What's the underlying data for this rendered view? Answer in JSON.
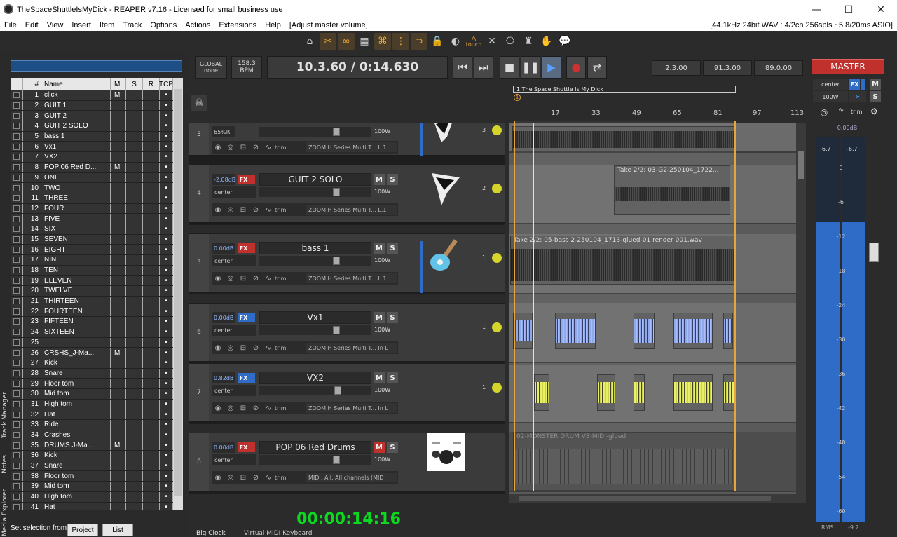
{
  "titlebar": {
    "title": "TheSpaceShuttleIsMyDick - REAPER v7.16 - Licensed for small business use",
    "min": "—",
    "max": "☐",
    "close": "✕"
  },
  "menu": {
    "items": [
      "File",
      "Edit",
      "View",
      "Insert",
      "Item",
      "Track",
      "Options",
      "Actions",
      "Extensions",
      "Help",
      "[Adjust master volume]"
    ],
    "status": "[44.1kHz 24bit WAV : 4/2ch 256spls ~5.8/20ms ASIO]"
  },
  "toolbar": {
    "touch_label": "touch"
  },
  "track_manager": {
    "headers": [
      "#",
      "Name",
      "M",
      "S",
      "R",
      "TCP"
    ],
    "rows": [
      {
        "n": "1",
        "name": "click",
        "m": "M",
        "tcp": "•"
      },
      {
        "n": "2",
        "name": "GUIT 1",
        "m": "",
        "tcp": "•"
      },
      {
        "n": "3",
        "name": "GUIT 2",
        "m": "",
        "tcp": "•"
      },
      {
        "n": "4",
        "name": "GUIT 2 SOLO",
        "m": "",
        "tcp": "•"
      },
      {
        "n": "5",
        "name": "bass 1",
        "m": "",
        "tcp": "•"
      },
      {
        "n": "6",
        "name": "Vx1",
        "m": "",
        "tcp": "•"
      },
      {
        "n": "7",
        "name": "VX2",
        "m": "",
        "tcp": "•"
      },
      {
        "n": "8",
        "name": "POP 06 Red D...",
        "m": "M",
        "tcp": "•"
      },
      {
        "n": "9",
        "name": "ONE",
        "m": "",
        "tcp": "•"
      },
      {
        "n": "10",
        "name": "TWO",
        "m": "",
        "tcp": "•"
      },
      {
        "n": "11",
        "name": "THREE",
        "m": "",
        "tcp": "•"
      },
      {
        "n": "12",
        "name": "FOUR",
        "m": "",
        "tcp": "•"
      },
      {
        "n": "13",
        "name": "FIVE",
        "m": "",
        "tcp": "•"
      },
      {
        "n": "14",
        "name": "SIX",
        "m": "",
        "tcp": "•"
      },
      {
        "n": "15",
        "name": "SEVEN",
        "m": "",
        "tcp": "•"
      },
      {
        "n": "16",
        "name": "EIGHT",
        "m": "",
        "tcp": "•"
      },
      {
        "n": "17",
        "name": "NINE",
        "m": "",
        "tcp": "•"
      },
      {
        "n": "18",
        "name": "TEN",
        "m": "",
        "tcp": "•"
      },
      {
        "n": "19",
        "name": "ELEVEN",
        "m": "",
        "tcp": "•"
      },
      {
        "n": "20",
        "name": "TWELVE",
        "m": "",
        "tcp": "•"
      },
      {
        "n": "21",
        "name": "THIRTEEN",
        "m": "",
        "tcp": "•"
      },
      {
        "n": "22",
        "name": "FOURTEEN",
        "m": "",
        "tcp": "•"
      },
      {
        "n": "23",
        "name": "FIFTEEN",
        "m": "",
        "tcp": "•"
      },
      {
        "n": "24",
        "name": "SIXTEEN",
        "m": "",
        "tcp": "•"
      },
      {
        "n": "25",
        "name": "",
        "m": "",
        "tcp": "•"
      },
      {
        "n": "26",
        "name": "CRSHS_J-Ma...",
        "m": "M",
        "tcp": "•"
      },
      {
        "n": "27",
        "name": "Kick",
        "m": "",
        "tcp": "•"
      },
      {
        "n": "28",
        "name": "Snare",
        "m": "",
        "tcp": "•"
      },
      {
        "n": "29",
        "name": "Floor tom",
        "m": "",
        "tcp": "•"
      },
      {
        "n": "30",
        "name": "Mid tom",
        "m": "",
        "tcp": "•"
      },
      {
        "n": "31",
        "name": "High tom",
        "m": "",
        "tcp": "•"
      },
      {
        "n": "32",
        "name": "Hat",
        "m": "",
        "tcp": "•"
      },
      {
        "n": "33",
        "name": "Ride",
        "m": "",
        "tcp": "•"
      },
      {
        "n": "34",
        "name": "Crashes",
        "m": "",
        "tcp": "•"
      },
      {
        "n": "35",
        "name": "DRUMS J-Ma...",
        "m": "M",
        "tcp": "•"
      },
      {
        "n": "36",
        "name": "Kick",
        "m": "",
        "tcp": "•"
      },
      {
        "n": "37",
        "name": "Snare",
        "m": "",
        "tcp": "•"
      },
      {
        "n": "38",
        "name": "Floor tom",
        "m": "",
        "tcp": "•"
      },
      {
        "n": "39",
        "name": "Mid tom",
        "m": "",
        "tcp": "•"
      },
      {
        "n": "40",
        "name": "High tom",
        "m": "",
        "tcp": "•"
      },
      {
        "n": "41",
        "name": "Hat",
        "m": "",
        "tcp": "•"
      }
    ]
  },
  "sidetabs": {
    "track_manager": "Track Manager",
    "notes": "Notes",
    "media_explorer": "Media Explorer"
  },
  "selection": {
    "label": "Set selection from:",
    "project": "Project",
    "list": "List"
  },
  "transport": {
    "global_label": "GLOBAL",
    "global_sub": "none",
    "bpm_value": "158.3",
    "bpm_label": "BPM",
    "time": "10.3.60 / 0:14.630",
    "sel_start": "2.3.00",
    "sel_end": "91.3.00",
    "sel_len": "89.0.00"
  },
  "tracks": [
    {
      "num": "3",
      "vol": "65%R",
      "width": "100W",
      "fx_chain": "ZOOM H Series Multi T... L.1",
      "rec_in": "3"
    },
    {
      "num": "4",
      "vol": "-2.08dB",
      "name": "GUIT 2 SOLO",
      "pan": "center",
      "width": "100W",
      "fx_chain": "ZOOM H Series Multi T... L.1",
      "rec_in": "2"
    },
    {
      "num": "5",
      "vol": "0.00dB",
      "name": "bass 1",
      "pan": "center",
      "width": "100W",
      "fx_chain": "ZOOM H Series Multi T... L.1",
      "rec_in": "1"
    },
    {
      "num": "6",
      "vol": "0.00dB",
      "name": "Vx1",
      "pan": "center",
      "width": "100W",
      "fx_chain": "ZOOM H Series Multi T... In L",
      "rec_in": "1"
    },
    {
      "num": "7",
      "vol": "0.82dB",
      "name": "VX2",
      "pan": "center",
      "width": "100W",
      "fx_chain": "ZOOM H Series Multi T... In L",
      "rec_in": "1"
    },
    {
      "num": "8",
      "vol": "0.00dB",
      "name": "POP 06 Red Drums",
      "pan": "center",
      "width": "100W",
      "fx_chain": "MIDI: All: All channels (MID"
    }
  ],
  "tcp_common": {
    "fx": "FX",
    "m": "M",
    "s": "S",
    "trim": "trim"
  },
  "arrange": {
    "region": "1 The Space Shuttle Is My Dick",
    "marker": "1",
    "ruler_ticks": [
      "17",
      "33",
      "49",
      "65",
      "81",
      "97",
      "113"
    ],
    "item_guit2solo": "Take 2/2: 03-G2-250104_1722...",
    "item_bass": "Take 2/2: 05-bass 2-250104_1713-glued-01 render 001.wav",
    "item_drums": "02-MONSTER DRUM V3-MIDI-glued"
  },
  "bigclock": {
    "time": "00:00:14:16"
  },
  "bottomtabs": {
    "big_clock": "Big Clock",
    "virtual_midi": "Virtual MIDI Keyboard"
  },
  "master": {
    "label": "MASTER",
    "pan": "center",
    "width": "100W",
    "fx": "FX",
    "m": "M",
    "s": "S",
    "trim": "trim",
    "peak": "0.00dB",
    "peak_l": "-6.7",
    "peak_r": "-6.7",
    "scale": [
      "0",
      "-6",
      "-12",
      "-18",
      "-24",
      "-30",
      "-36",
      "-42",
      "-48",
      "-54",
      "-60"
    ],
    "rms_label": "RMS",
    "rms_value": "-9.2",
    "level_l": 0.78,
    "level_r": 0.78
  }
}
